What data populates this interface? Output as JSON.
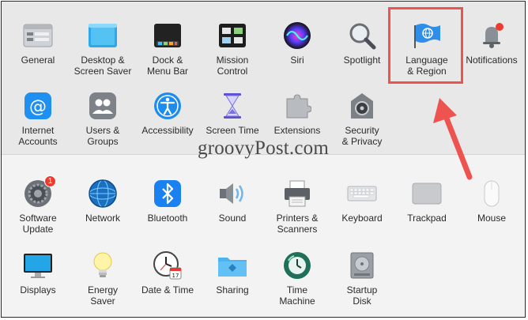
{
  "watermark": "groovyPost.com",
  "accent_color": "#ef5350",
  "items": [
    {
      "key": "general",
      "label": "General",
      "icon": "general-icon",
      "interactable": true
    },
    {
      "key": "desktop",
      "label": "Desktop &\nScreen Saver",
      "icon": "desktop-screen-saver-icon",
      "interactable": true
    },
    {
      "key": "dock",
      "label": "Dock &\nMenu Bar",
      "icon": "dock-menu-bar-icon",
      "interactable": true
    },
    {
      "key": "mission",
      "label": "Mission\nControl",
      "icon": "mission-control-icon",
      "interactable": true
    },
    {
      "key": "siri",
      "label": "Siri",
      "icon": "siri-icon",
      "interactable": true
    },
    {
      "key": "spotlight",
      "label": "Spotlight",
      "icon": "spotlight-icon",
      "interactable": true
    },
    {
      "key": "language",
      "label": "Language\n& Region",
      "icon": "language-region-flag-icon",
      "interactable": true
    },
    {
      "key": "notifications",
      "label": "Notifications",
      "icon": "notifications-bell-icon",
      "interactable": true
    },
    {
      "key": "internet",
      "label": "Internet\nAccounts",
      "icon": "internet-accounts-icon",
      "interactable": true
    },
    {
      "key": "users",
      "label": "Users &\nGroups",
      "icon": "users-groups-icon",
      "interactable": true
    },
    {
      "key": "accessibility",
      "label": "Accessibility",
      "icon": "accessibility-icon",
      "interactable": true
    },
    {
      "key": "screentime",
      "label": "Screen Time",
      "icon": "screen-time-hourglass-icon",
      "interactable": true
    },
    {
      "key": "extensions",
      "label": "Extensions",
      "icon": "extensions-puzzle-icon",
      "interactable": true
    },
    {
      "key": "security",
      "label": "Security\n& Privacy",
      "icon": "security-privacy-icon",
      "interactable": true
    },
    {
      "key": "software",
      "label": "Software\nUpdate",
      "icon": "software-update-gear-icon",
      "badge": "1",
      "interactable": true
    },
    {
      "key": "network",
      "label": "Network",
      "icon": "network-globe-icon",
      "interactable": true
    },
    {
      "key": "bluetooth",
      "label": "Bluetooth",
      "icon": "bluetooth-icon",
      "interactable": true
    },
    {
      "key": "sound",
      "label": "Sound",
      "icon": "sound-speaker-icon",
      "interactable": true
    },
    {
      "key": "printers",
      "label": "Printers &\nScanners",
      "icon": "printer-icon",
      "interactable": true
    },
    {
      "key": "keyboard",
      "label": "Keyboard",
      "icon": "keyboard-icon",
      "interactable": true
    },
    {
      "key": "trackpad",
      "label": "Trackpad",
      "icon": "trackpad-icon",
      "interactable": true
    },
    {
      "key": "mouse",
      "label": "Mouse",
      "icon": "mouse-icon",
      "interactable": true
    },
    {
      "key": "displays",
      "label": "Displays",
      "icon": "displays-monitor-icon",
      "interactable": true
    },
    {
      "key": "energy",
      "label": "Energy\nSaver",
      "icon": "energy-saver-bulb-icon",
      "interactable": true
    },
    {
      "key": "datetime",
      "label": "Date & Time",
      "icon": "date-time-clock-icon",
      "calendar_day": "17",
      "interactable": true
    },
    {
      "key": "sharing",
      "label": "Sharing",
      "icon": "sharing-folder-icon",
      "interactable": true
    },
    {
      "key": "timemachine",
      "label": "Time\nMachine",
      "icon": "time-machine-icon",
      "interactable": true
    },
    {
      "key": "startup",
      "label": "Startup\nDisk",
      "icon": "startup-disk-icon",
      "interactable": true
    }
  ]
}
